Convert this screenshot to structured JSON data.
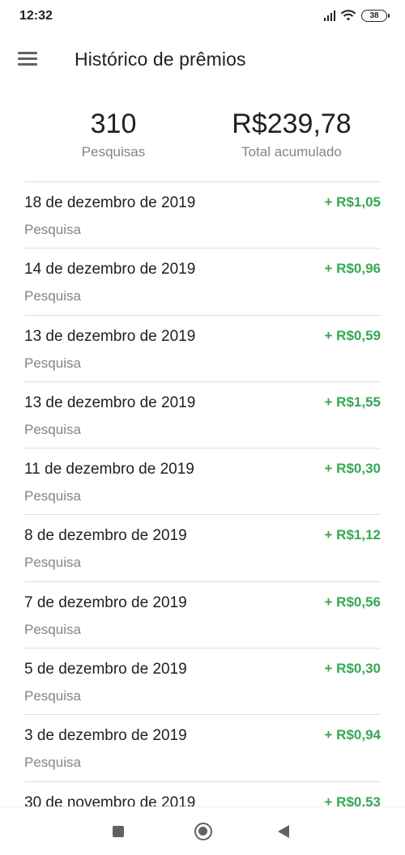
{
  "status_bar": {
    "time": "12:32",
    "battery": "38"
  },
  "app_bar": {
    "title": "Histórico de prêmios"
  },
  "stats": {
    "surveys_value": "310",
    "surveys_label": "Pesquisas",
    "total_value": "R$239,78",
    "total_label": "Total acumulado"
  },
  "rewards": [
    {
      "date": "18 de dezembro de 2019",
      "type": "Pesquisa",
      "amount": "+ R$1,05"
    },
    {
      "date": "14 de dezembro de 2019",
      "type": "Pesquisa",
      "amount": "+ R$0,96"
    },
    {
      "date": "13 de dezembro de 2019",
      "type": "Pesquisa",
      "amount": "+ R$0,59"
    },
    {
      "date": "13 de dezembro de 2019",
      "type": "Pesquisa",
      "amount": "+ R$1,55"
    },
    {
      "date": "11 de dezembro de 2019",
      "type": "Pesquisa",
      "amount": "+ R$0,30"
    },
    {
      "date": "8 de dezembro de 2019",
      "type": "Pesquisa",
      "amount": "+ R$1,12"
    },
    {
      "date": "7 de dezembro de 2019",
      "type": "Pesquisa",
      "amount": "+ R$0,56"
    },
    {
      "date": "5 de dezembro de 2019",
      "type": "Pesquisa",
      "amount": "+ R$0,30"
    },
    {
      "date": "3 de dezembro de 2019",
      "type": "Pesquisa",
      "amount": "+ R$0,94"
    },
    {
      "date": "30 de novembro de 2019",
      "type": "",
      "amount": "+ R$0,53"
    }
  ],
  "colors": {
    "amount_positive": "#34a853",
    "secondary_text": "#80868b",
    "primary_text": "#202124"
  },
  "icons": {
    "menu": "hamburger-menu-icon",
    "signal": "cellular-signal-icon",
    "wifi": "wifi-icon",
    "battery": "battery-icon",
    "nav_recent": "recent-apps-icon",
    "nav_home": "home-icon",
    "nav_back": "back-icon"
  }
}
